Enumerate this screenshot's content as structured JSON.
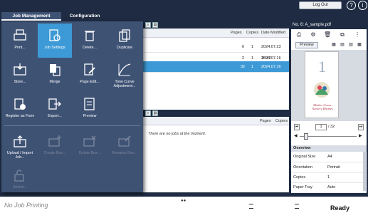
{
  "header": {
    "logout_label": "Log Out"
  },
  "tabs": [
    {
      "label": "Job Management"
    },
    {
      "label": "Configuration"
    }
  ],
  "job_list": {
    "columns": {
      "pages": "Pages",
      "copies": "Copies",
      "date_modified": "Date Modified"
    },
    "rows": [
      {
        "pages": "6",
        "copies": "1",
        "date": "2024.07.23 15:47"
      },
      {
        "pages": "2",
        "copies": "1",
        "date": "2024.07.16 12:45"
      },
      {
        "pages": "32",
        "copies": "1",
        "date": "2024.07.16 12:45"
      }
    ]
  },
  "queue": {
    "columns": {
      "pages": "Pages",
      "copies": "Copies"
    },
    "empty_text": "There are no jobs at the moment."
  },
  "menu": {
    "items": [
      {
        "label": "Print...",
        "icon": "print-icon"
      },
      {
        "label": "Job Settings",
        "icon": "job-settings-icon"
      },
      {
        "label": "Delete...",
        "icon": "trash-icon"
      },
      {
        "label": "Duplicate",
        "icon": "duplicate-icon"
      },
      {
        "label": "Store...",
        "icon": "store-icon"
      },
      {
        "label": "Merge",
        "icon": "merge-icon"
      },
      {
        "label": "Page Edit...",
        "icon": "page-edit-icon"
      },
      {
        "label": "Tone Curve Adjustment...",
        "icon": "tone-curve-icon"
      },
      {
        "label": "Register as Form",
        "icon": "register-form-icon"
      },
      {
        "label": "Export...",
        "icon": "export-icon"
      },
      {
        "label": "Preview",
        "icon": "preview-icon"
      },
      {
        "label": "Upload / Import Job...",
        "icon": "upload-icon"
      },
      {
        "label": "Create Box...",
        "icon": "create-box-icon"
      },
      {
        "label": "Delete Box...",
        "icon": "delete-box-icon"
      },
      {
        "label": "Rename Box...",
        "icon": "rename-box-icon"
      },
      {
        "label": "Unlock...",
        "icon": "unlock-icon"
      }
    ]
  },
  "detail": {
    "title": "No. 6: A_sample.pdf",
    "preview_label": "Preview",
    "thumbnail": {
      "number": "1",
      "line1": "Mother Goose",
      "line2": "Nursery Rhymes"
    },
    "page_current": "1",
    "page_total": "/ 32",
    "overview_title": "Overview",
    "overview": [
      {
        "key": "Original Size",
        "value": "A4"
      },
      {
        "key": "Orientation",
        "value": "Portrait"
      },
      {
        "key": "Copies",
        "value": "1"
      },
      {
        "key": "Paper Tray",
        "value": "Auto"
      }
    ]
  },
  "status": {
    "printing": "No Job Printing",
    "state": "Ready"
  },
  "colors": {
    "navy": "#1e2b42",
    "menu": "#3e5274",
    "accent": "#3d9ad6"
  }
}
